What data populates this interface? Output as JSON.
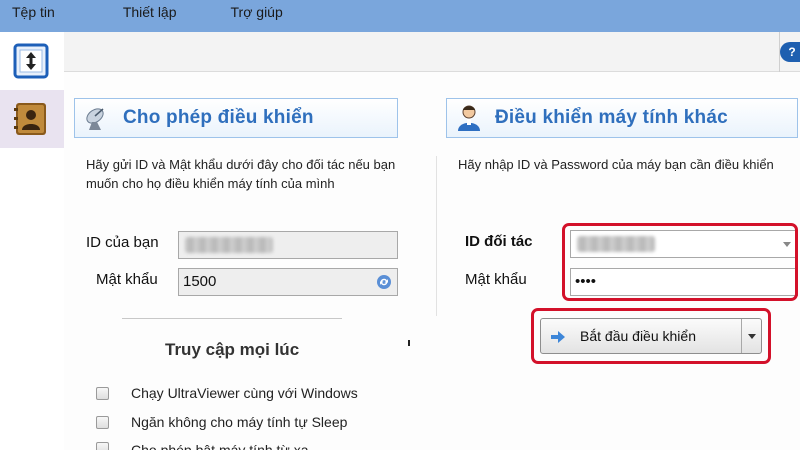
{
  "menu": {
    "file": "Tệp tin",
    "settings": "Thiết lập",
    "help": "Trợ giúp"
  },
  "toolbar": {
    "help_glyph": "?"
  },
  "left_panel": {
    "title": "Cho phép điều khiển",
    "description": "Hãy gửi ID và Mật khẩu dưới đây cho đối tác nếu bạn muốn cho họ điều khiển máy tính của mình",
    "id_label": "ID của bạn",
    "password_label": "Mật khẩu",
    "password_value": "1500",
    "access_title": "Truy cập mọi lúc",
    "options": [
      {
        "label": "Chạy UltraViewer cùng với Windows",
        "checked": false
      },
      {
        "label": "Ngăn không cho máy tính tự Sleep",
        "checked": false
      },
      {
        "label": "Cho phép bật máy tính từ xa",
        "checked": false
      }
    ]
  },
  "right_panel": {
    "title": "Điều khiển máy tính khác",
    "description": "Hãy nhập ID và Password của máy bạn cần điều khiển",
    "partner_id_label": "ID đối tác",
    "password_label": "Mật khẩu",
    "password_value": "••••",
    "start_button": "Bắt đầu điều khiển"
  },
  "colors": {
    "menubar": "#7aa6dc",
    "header_text": "#2f6fbd",
    "highlight": "#d3112a"
  },
  "icons": {
    "transfer": "transfer-arrows-icon",
    "contacts": "contact-book-icon",
    "satellite": "satellite-dish-icon",
    "user": "user-icon",
    "refresh": "refresh-icon",
    "arrow": "arrow-right-icon"
  }
}
